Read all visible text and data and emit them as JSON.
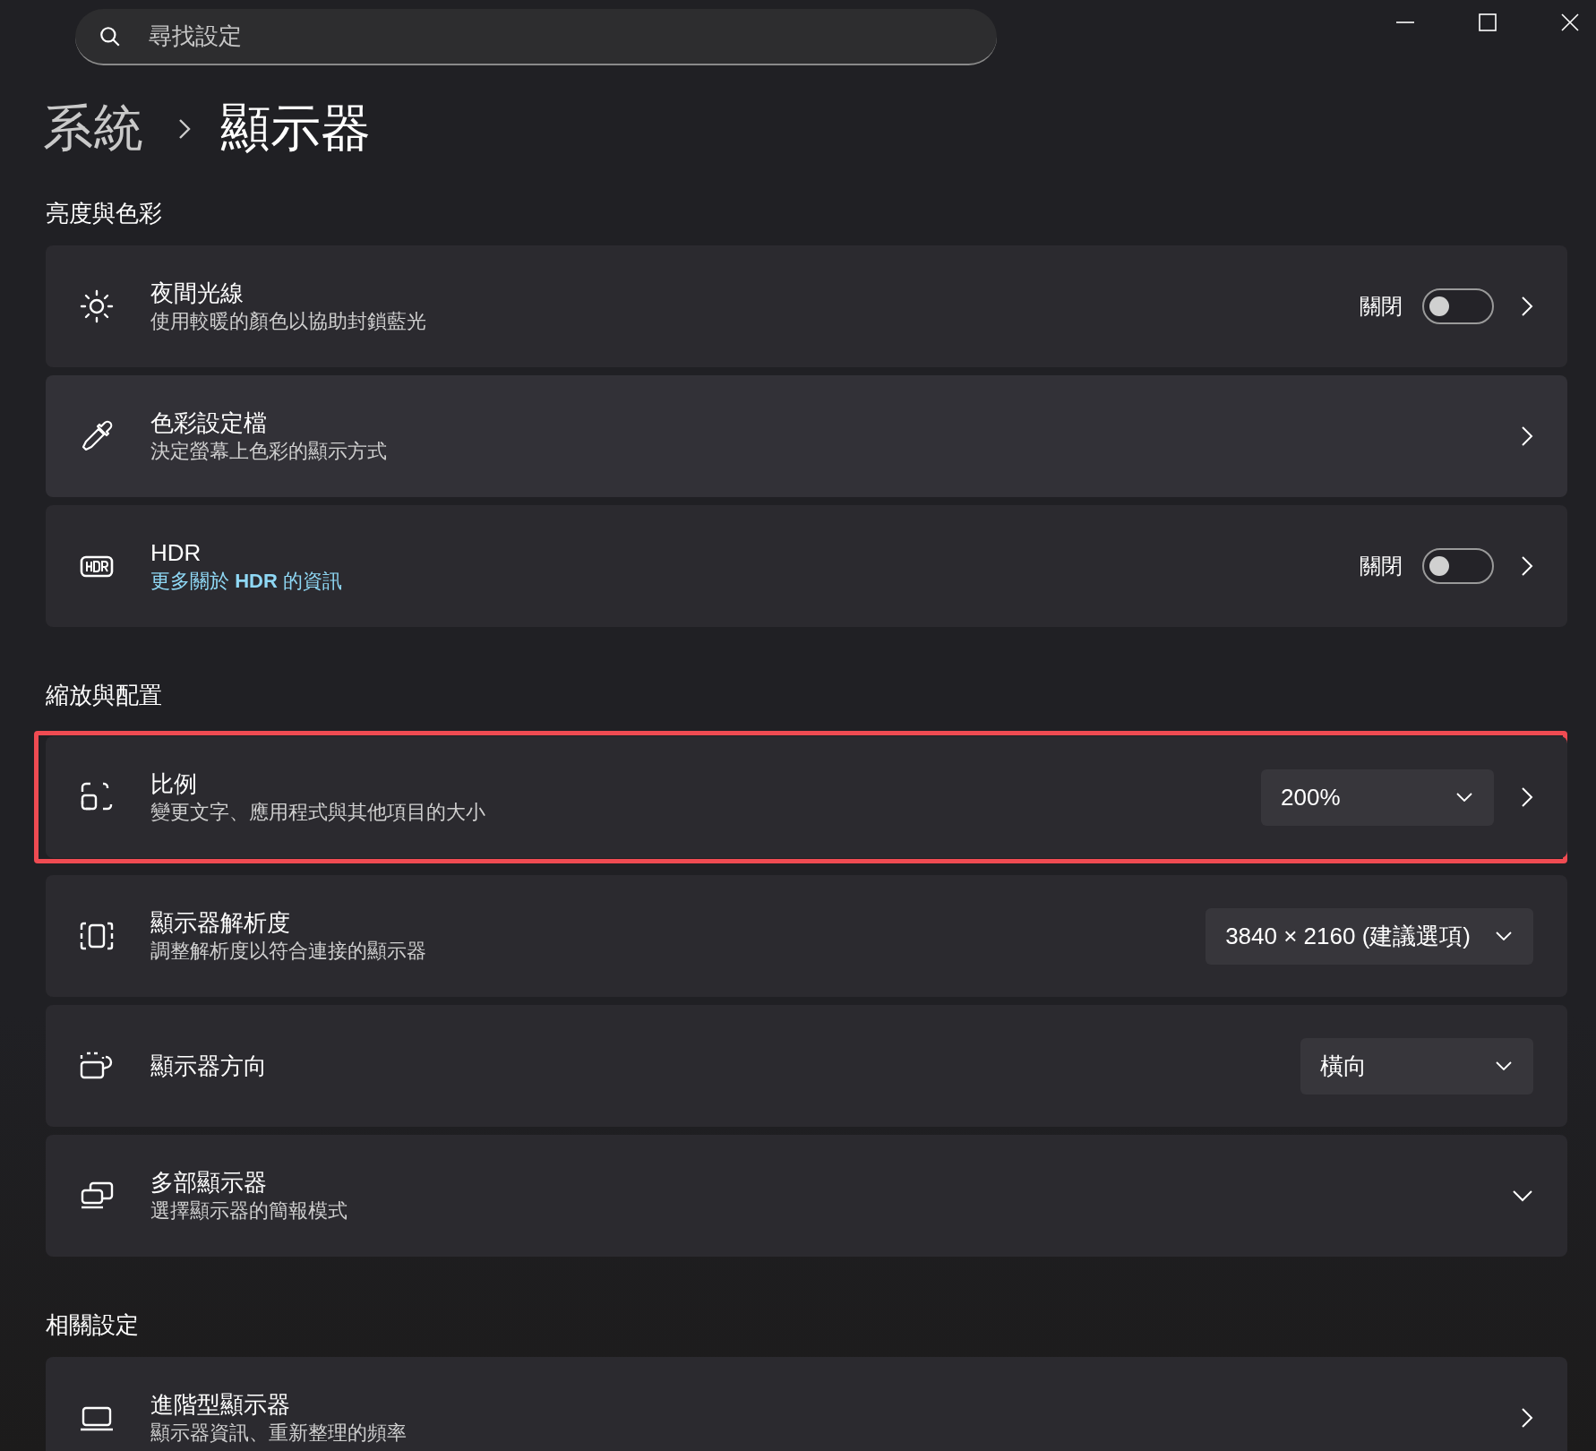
{
  "search": {
    "placeholder": "尋找設定"
  },
  "breadcrumb": {
    "parent": "系統",
    "current": "顯示器"
  },
  "sections": [
    {
      "title": "亮度與色彩",
      "items": [
        {
          "title": "夜間光線",
          "subtitle": "使用較暖的顏色以協助封鎖藍光",
          "subtitle_link": false,
          "control": {
            "kind": "toggle",
            "label": "關閉",
            "on": false
          },
          "expandable": false,
          "highlighted": false
        },
        {
          "title": "色彩設定檔",
          "subtitle": "決定螢幕上色彩的顯示方式",
          "subtitle_link": false,
          "expandable": false,
          "highlighted": false
        },
        {
          "title": "HDR",
          "subtitle": "更多關於 **HDR** 的資訊",
          "subtitle_link": true,
          "control": {
            "kind": "toggle",
            "label": "關閉",
            "on": false
          },
          "expandable": false,
          "highlighted": false
        }
      ]
    },
    {
      "title": "縮放與配置",
      "items": [
        {
          "title": "比例",
          "subtitle": "變更文字、應用程式與其他項目的大小",
          "subtitle_link": false,
          "control": {
            "kind": "dropdown",
            "value": "200%",
            "chevron": true
          },
          "expandable": false,
          "highlighted": true
        },
        {
          "title": "顯示器解析度",
          "subtitle": "調整解析度以符合連接的顯示器",
          "subtitle_link": false,
          "control": {
            "kind": "dropdown",
            "value": "3840 × 2160 (建議選項)",
            "chevron": false
          },
          "expandable": false,
          "highlighted": false
        },
        {
          "title": "顯示器方向",
          "control": {
            "kind": "dropdown",
            "value": "橫向",
            "chevron": false
          },
          "expandable": false,
          "highlighted": false
        },
        {
          "title": "多部顯示器",
          "subtitle": "選擇顯示器的簡報模式",
          "subtitle_link": false,
          "expandable": true,
          "highlighted": false
        }
      ]
    },
    {
      "title": "相關設定",
      "items": [
        {
          "title": "進階型顯示器",
          "subtitle": "顯示器資訊、重新整理的頻率",
          "subtitle_link": false,
          "expandable": false,
          "highlighted": false
        }
      ]
    }
  ]
}
